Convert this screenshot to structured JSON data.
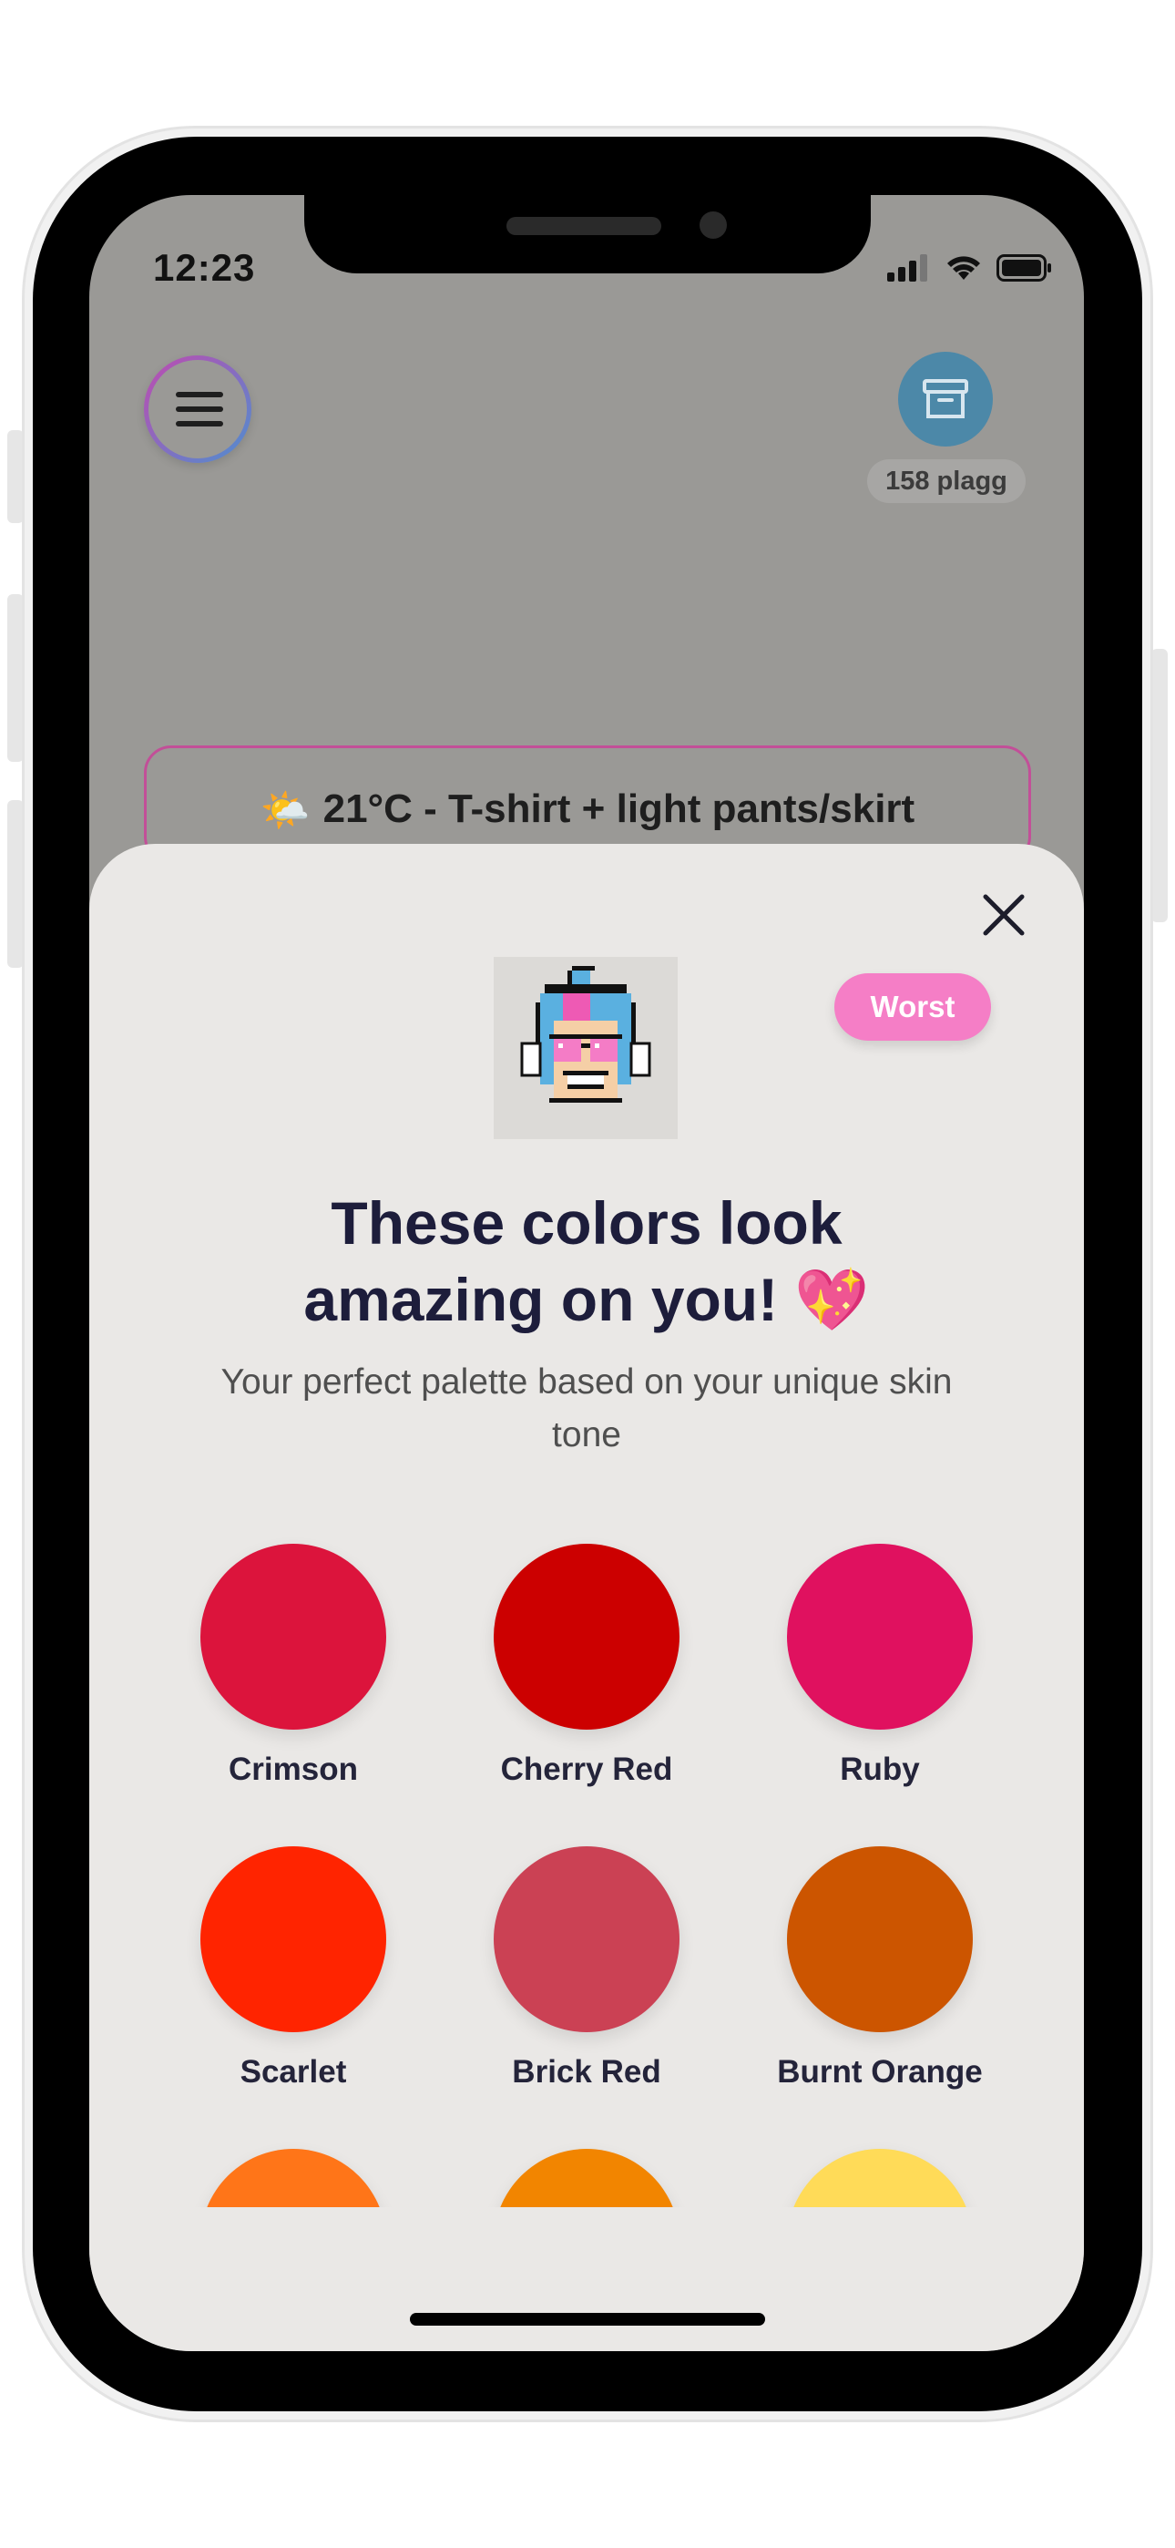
{
  "status_bar": {
    "time": "12:23"
  },
  "header": {
    "wardrobe_count": "158 plagg"
  },
  "weather": {
    "emoji": "🌤️",
    "text": "21°C - T-shirt + light pants/skirt"
  },
  "sheet": {
    "badge": "Worst",
    "title_line1": "These colors look",
    "title_line2": "amazing on you! 💖",
    "subtitle": "Your perfect palette based on your unique skin tone",
    "colors": [
      {
        "name": "Crimson",
        "hex": "#DC143C"
      },
      {
        "name": "Cherry Red",
        "hex": "#CC0000"
      },
      {
        "name": "Ruby",
        "hex": "#E0115F"
      },
      {
        "name": "Scarlet",
        "hex": "#FF2400"
      },
      {
        "name": "Brick Red",
        "hex": "#CB4154"
      },
      {
        "name": "Burnt Orange",
        "hex": "#CC5500"
      },
      {
        "name": "",
        "hex": "#FF7518"
      },
      {
        "name": "",
        "hex": "#F28500"
      },
      {
        "name": "",
        "hex": "#FFDB58"
      }
    ]
  }
}
